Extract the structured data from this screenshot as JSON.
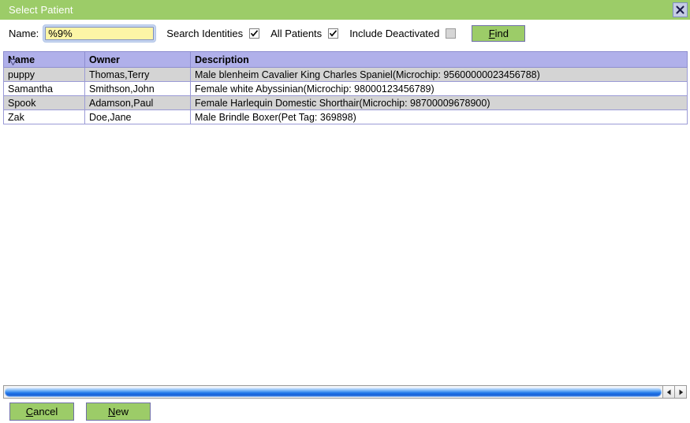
{
  "window": {
    "title": "Select Patient",
    "close_icon": "close-x-icon"
  },
  "toolbar": {
    "name_label": "Name:",
    "name_value": "%9%",
    "name_placeholder": "",
    "search_identities_label": "Search Identities",
    "search_identities_checked": true,
    "all_patients_label": "All Patients",
    "all_patients_checked": true,
    "include_deactivated_label": "Include Deactivated",
    "include_deactivated_checked": false,
    "find_label_prefix": "",
    "find_label_mnemonic": "F",
    "find_label_suffix": "ind",
    "find_label": "Find"
  },
  "table": {
    "sort_icon": "sort-descending-triangle-icon",
    "columns": [
      {
        "label": "Name"
      },
      {
        "label": "Owner"
      },
      {
        "label": "Description"
      }
    ],
    "rows": [
      {
        "name": "puppy",
        "owner": "Thomas,Terry",
        "description": "Male blenheim Cavalier King Charles Spaniel(Microchip: 95600000023456788)"
      },
      {
        "name": "Samantha",
        "owner": "Smithson,John",
        "description": "Female white Abyssinian(Microchip: 98000123456789)"
      },
      {
        "name": "Spook",
        "owner": "Adamson,Paul",
        "description": "Female Harlequin Domestic Shorthair(Microchip: 98700009678900)"
      },
      {
        "name": "Zak",
        "owner": "Doe,Jane",
        "description": "Male Brindle Boxer(Pet Tag: 369898)"
      }
    ]
  },
  "scrollbar": {
    "left_arrow_icon": "triangle-left-icon",
    "right_arrow_icon": "triangle-right-icon"
  },
  "footer": {
    "cancel_mnemonic": "C",
    "cancel_suffix": "ancel",
    "cancel_label": "Cancel",
    "new_mnemonic": "N",
    "new_suffix": "ew",
    "new_label": "New"
  },
  "colors": {
    "titlebar_green": "#9ccc68",
    "button_green": "#9ccc68",
    "header_purple": "#b0b0ea",
    "row_alt_gray": "#d4d4d4",
    "input_yellow": "#fcf5a6",
    "scroll_thumb_blue": "#1e74e8"
  }
}
